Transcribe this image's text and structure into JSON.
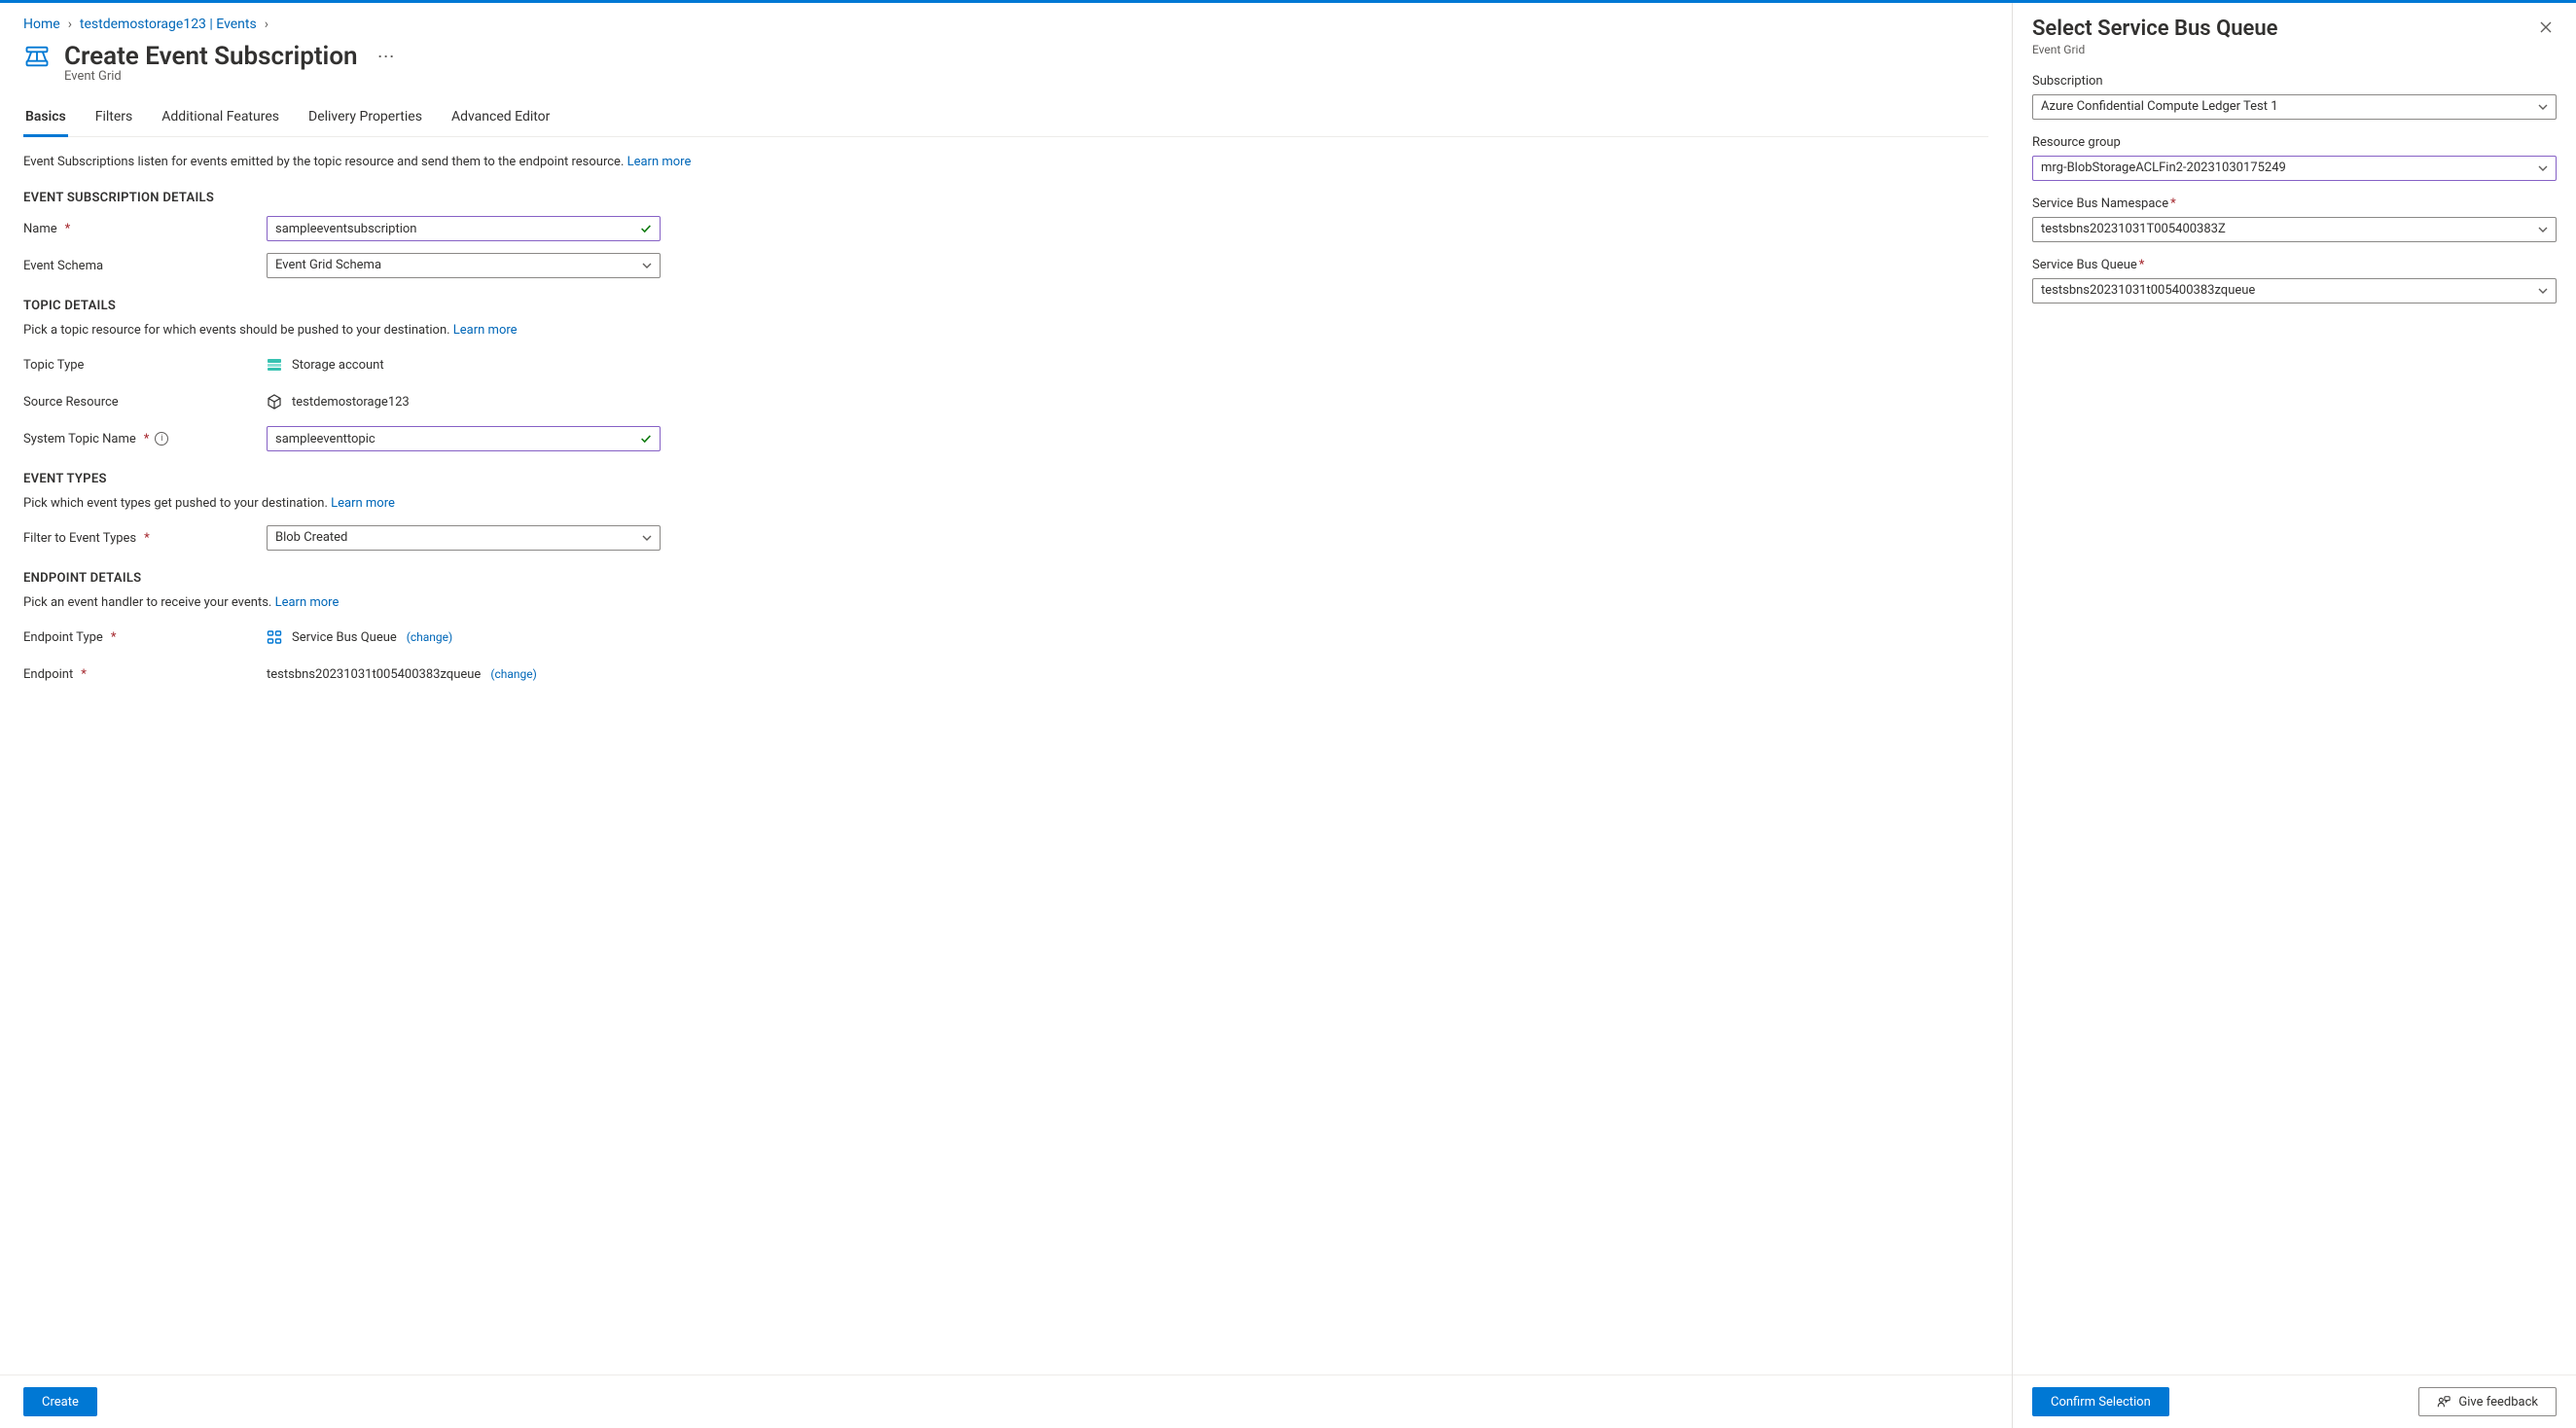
{
  "breadcrumb": {
    "home": "Home",
    "resource": "testdemostorage123 | Events"
  },
  "header": {
    "title": "Create Event Subscription",
    "service": "Event Grid"
  },
  "tabs": [
    {
      "label": "Basics",
      "active": true
    },
    {
      "label": "Filters"
    },
    {
      "label": "Additional Features"
    },
    {
      "label": "Delivery Properties"
    },
    {
      "label": "Advanced Editor"
    }
  ],
  "intro": {
    "text": "Event Subscriptions listen for events emitted by the topic resource and send them to the endpoint resource. ",
    "learn": "Learn more"
  },
  "sections": {
    "sub_details": {
      "title": "EVENT SUBSCRIPTION DETAILS",
      "name_label": "Name",
      "name_value": "sampleeventsubscription",
      "schema_label": "Event Schema",
      "schema_value": "Event Grid Schema"
    },
    "topic": {
      "title": "TOPIC DETAILS",
      "helper": "Pick a topic resource for which events should be pushed to your destination. ",
      "learn": "Learn more",
      "type_label": "Topic Type",
      "type_value": "Storage account",
      "source_label": "Source Resource",
      "source_value": "testdemostorage123",
      "systopic_label": "System Topic Name",
      "systopic_value": "sampleeventtopic"
    },
    "event_types": {
      "title": "EVENT TYPES",
      "helper": "Pick which event types get pushed to your destination. ",
      "learn": "Learn more",
      "filter_label": "Filter to Event Types",
      "filter_value": "Blob Created"
    },
    "endpoint": {
      "title": "ENDPOINT DETAILS",
      "helper": "Pick an event handler to receive your events. ",
      "learn": "Learn more",
      "type_label": "Endpoint Type",
      "type_value": "Service Bus Queue",
      "change": "change",
      "endpoint_label": "Endpoint",
      "endpoint_value": "testsbns20231031t005400383zqueue"
    }
  },
  "footer": {
    "create": "Create"
  },
  "panel": {
    "title": "Select Service Bus Queue",
    "service": "Event Grid",
    "fields": {
      "subscription": {
        "label": "Subscription",
        "value": "Azure Confidential Compute Ledger Test 1"
      },
      "rg": {
        "label": "Resource group",
        "value": "mrg-BlobStorageACLFin2-20231030175249"
      },
      "ns": {
        "label": "Service Bus Namespace",
        "value": "testsbns20231031T005400383Z"
      },
      "queue": {
        "label": "Service Bus Queue",
        "value": "testsbns20231031t005400383zqueue"
      }
    },
    "confirm": "Confirm Selection",
    "feedback": "Give feedback"
  }
}
